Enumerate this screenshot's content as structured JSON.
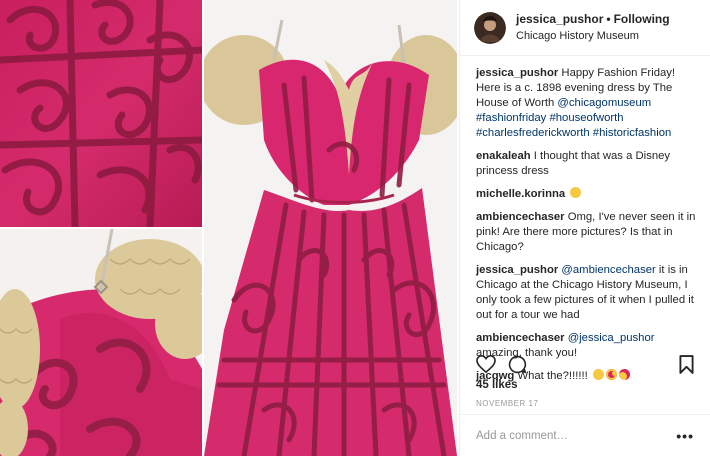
{
  "post": {
    "colors": {
      "dress": "#d8276e",
      "dress_dark": "#8e1d42",
      "lace": "#d9c79a",
      "link": "#003569",
      "muted": "#999999"
    },
    "media_icons": [
      "dress-detail-image",
      "dress-shoulder-image",
      "dress-full-image"
    ]
  },
  "header": {
    "username": "jessica_pushor",
    "separator": "•",
    "follow_status": "Following",
    "location": "Chicago History Museum",
    "avatar_icon": "user-avatar"
  },
  "caption": {
    "username": "jessica_pushor",
    "text": "Happy Fashion Friday! Here is a c. 1898 evening dress by The House of Worth",
    "mention": "@chicagomuseum",
    "hashtags": "#fashionfriday #houseofworth #charlesfrederickworth #historicfashion"
  },
  "comments": [
    {
      "username": "enakaleah",
      "text": "I thought that was a Disney princess dress"
    },
    {
      "username": "michelle.korinna",
      "text": "",
      "emoji": [
        "grin-emoji"
      ]
    },
    {
      "username": "ambiencechaser",
      "text": "Omg, I've never seen it in pink! Are there more pictures? Is that in Chicago?"
    },
    {
      "username": "jessica_pushor",
      "mention": "@ambiencechaser",
      "text": " it is in Chicago at the Chicago History Museum, I only took a few pictures of it when I pulled it out for a tour we had"
    },
    {
      "username": "ambiencechaser",
      "mention": "@jessica_pushor",
      "text": " amazing, thank you!"
    },
    {
      "username": "jacqwg",
      "text": "What the?!!!!!! ",
      "emoji": [
        "astonished-emoji",
        "heart-eyes-emoji",
        "kiss-emoji"
      ]
    }
  ],
  "actions": {
    "like_icon": "heart-icon",
    "comment_icon": "comment-icon",
    "save_icon": "bookmark-icon"
  },
  "likes": "45 likes",
  "date": "NOVEMBER 17",
  "add_comment": {
    "placeholder": "Add a comment…",
    "more_label": "•••"
  }
}
